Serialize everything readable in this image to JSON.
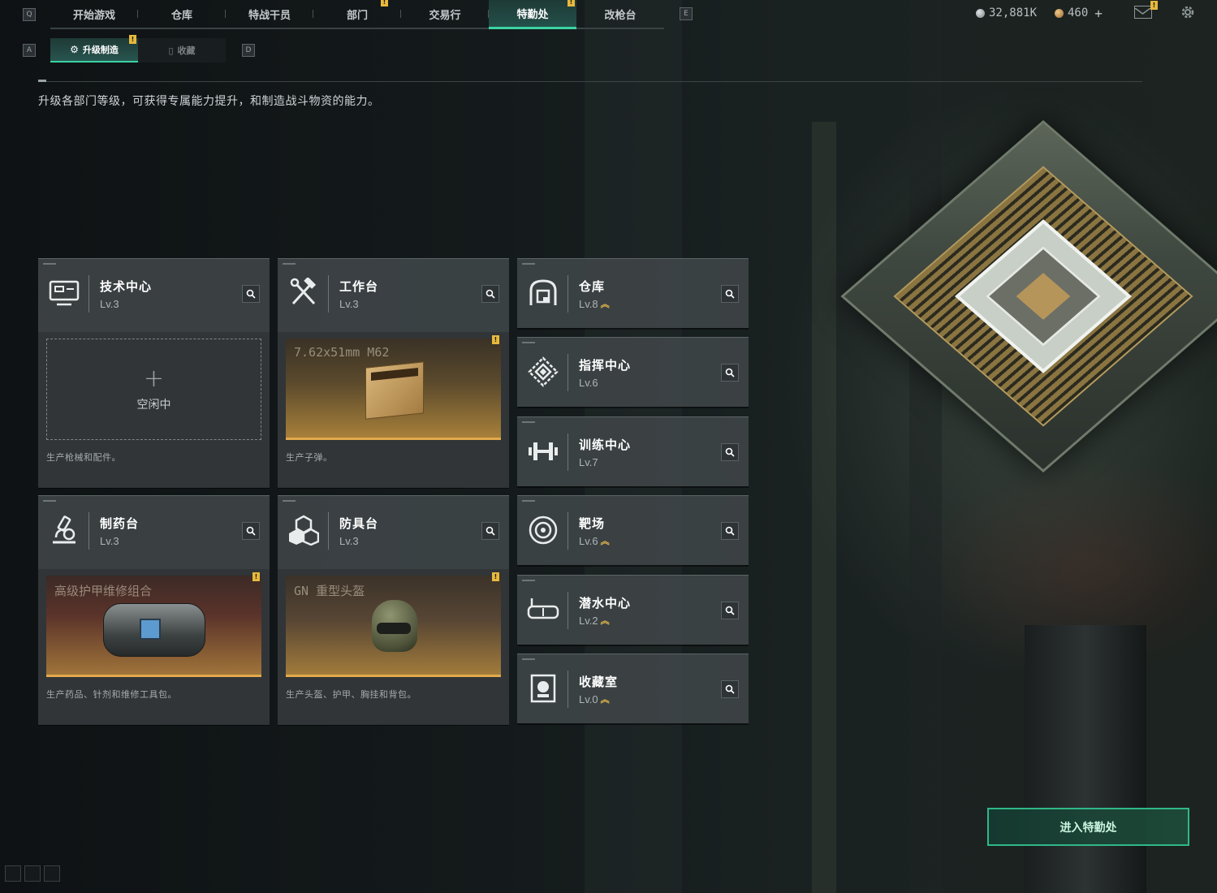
{
  "topnav": {
    "left_key": "Q",
    "right_key": "E",
    "tabs": [
      {
        "label": "开始游戏",
        "badge": ""
      },
      {
        "label": "仓库",
        "badge": ""
      },
      {
        "label": "特战干员",
        "badge": ""
      },
      {
        "label": "部门",
        "badge": "!"
      },
      {
        "label": "交易行",
        "badge": ""
      },
      {
        "label": "特勤处",
        "badge": "!",
        "active": true
      },
      {
        "label": "改枪台",
        "badge": ""
      }
    ],
    "currency_main": "32,881K",
    "currency_premium": "460",
    "add_label": "+",
    "mail_badge": "!"
  },
  "subnav": {
    "left_key": "A",
    "right_key": "D",
    "tabs": [
      {
        "label": "升级制造",
        "badge": "!",
        "active": true
      },
      {
        "label": "收藏"
      }
    ]
  },
  "description": "升级各部门等级，可获得专属能力提升，和制造战斗物资的能力。",
  "production_depts": [
    {
      "name": "技术中心",
      "level": "Lv.3",
      "icon": "monitor-icon",
      "slot_state": "idle",
      "idle_label": "空闲中",
      "plus": "+",
      "desc": "生产枪械和配件。"
    },
    {
      "name": "工作台",
      "level": "Lv.3",
      "icon": "hammer-wrench-icon",
      "slot_state": "busy",
      "item": "7.62x51mm M62",
      "badge": "!",
      "desc": "生产子弹。"
    },
    {
      "name": "制药台",
      "level": "Lv.3",
      "icon": "microscope-icon",
      "slot_state": "busy",
      "item": "高级护甲维修组合",
      "badge": "!",
      "desc": "生产药品、针剂和维修工具包。"
    },
    {
      "name": "防具台",
      "level": "Lv.3",
      "icon": "cubes-icon",
      "slot_state": "busy",
      "item": "GN 重型头盔",
      "badge": "!",
      "desc": "生产头盔、护甲、胸挂和背包。"
    }
  ],
  "other_depts": [
    {
      "name": "仓库",
      "level": "Lv.8",
      "upgradable": true,
      "icon": "warehouse-icon"
    },
    {
      "name": "指挥中心",
      "level": "Lv.6",
      "upgradable": false,
      "icon": "command-icon"
    },
    {
      "name": "训练中心",
      "level": "Lv.7",
      "upgradable": false,
      "icon": "dumbbell-icon"
    },
    {
      "name": "靶场",
      "level": "Lv.6",
      "upgradable": true,
      "icon": "target-icon"
    },
    {
      "name": "潜水中心",
      "level": "Lv.2",
      "upgradable": true,
      "icon": "diving-mask-icon"
    },
    {
      "name": "收藏室",
      "level": "Lv.0",
      "upgradable": true,
      "icon": "collection-icon"
    }
  ],
  "enter_button": "进入特勤处",
  "colors": {
    "accent": "#3bd3a2",
    "badge": "#e7b93c",
    "slot_gold": "#e3a94a"
  }
}
